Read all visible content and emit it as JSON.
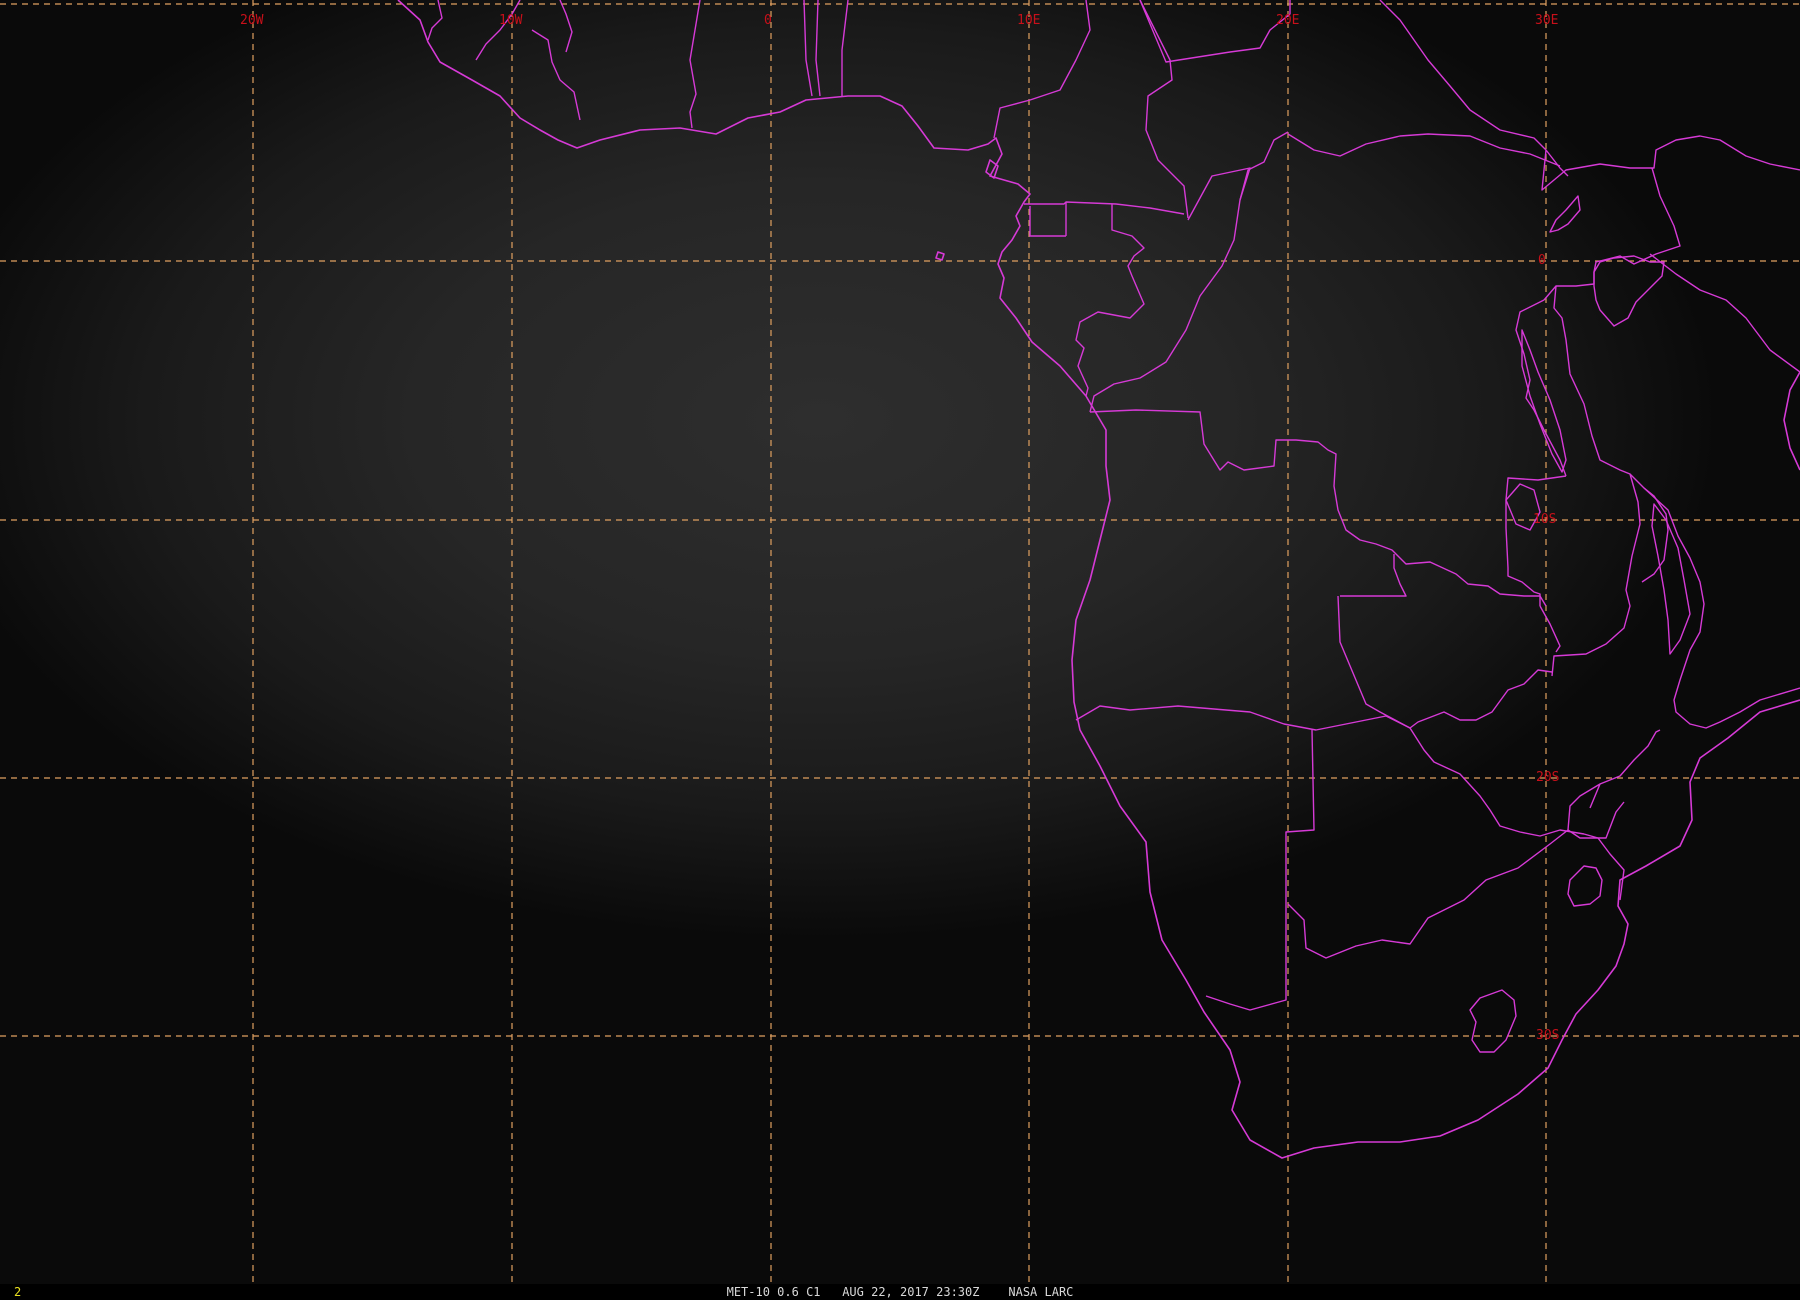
{
  "map": {
    "projection": "satellite view (west/central/southern Africa)",
    "colors": {
      "grid": "#e0a060",
      "grid_label": "#c8101a",
      "border": "#d63ad6",
      "background": "#262626"
    },
    "longitude_labels": [
      "20W",
      "10W",
      "0",
      "10E",
      "20E",
      "30E"
    ],
    "latitude_labels": [
      "0",
      "10S",
      "20S",
      "30S"
    ]
  },
  "status": {
    "frame_number": "2",
    "caption": "MET-10 0.6 C1   AUG 22, 2017 23:30Z    NASA LARC"
  }
}
